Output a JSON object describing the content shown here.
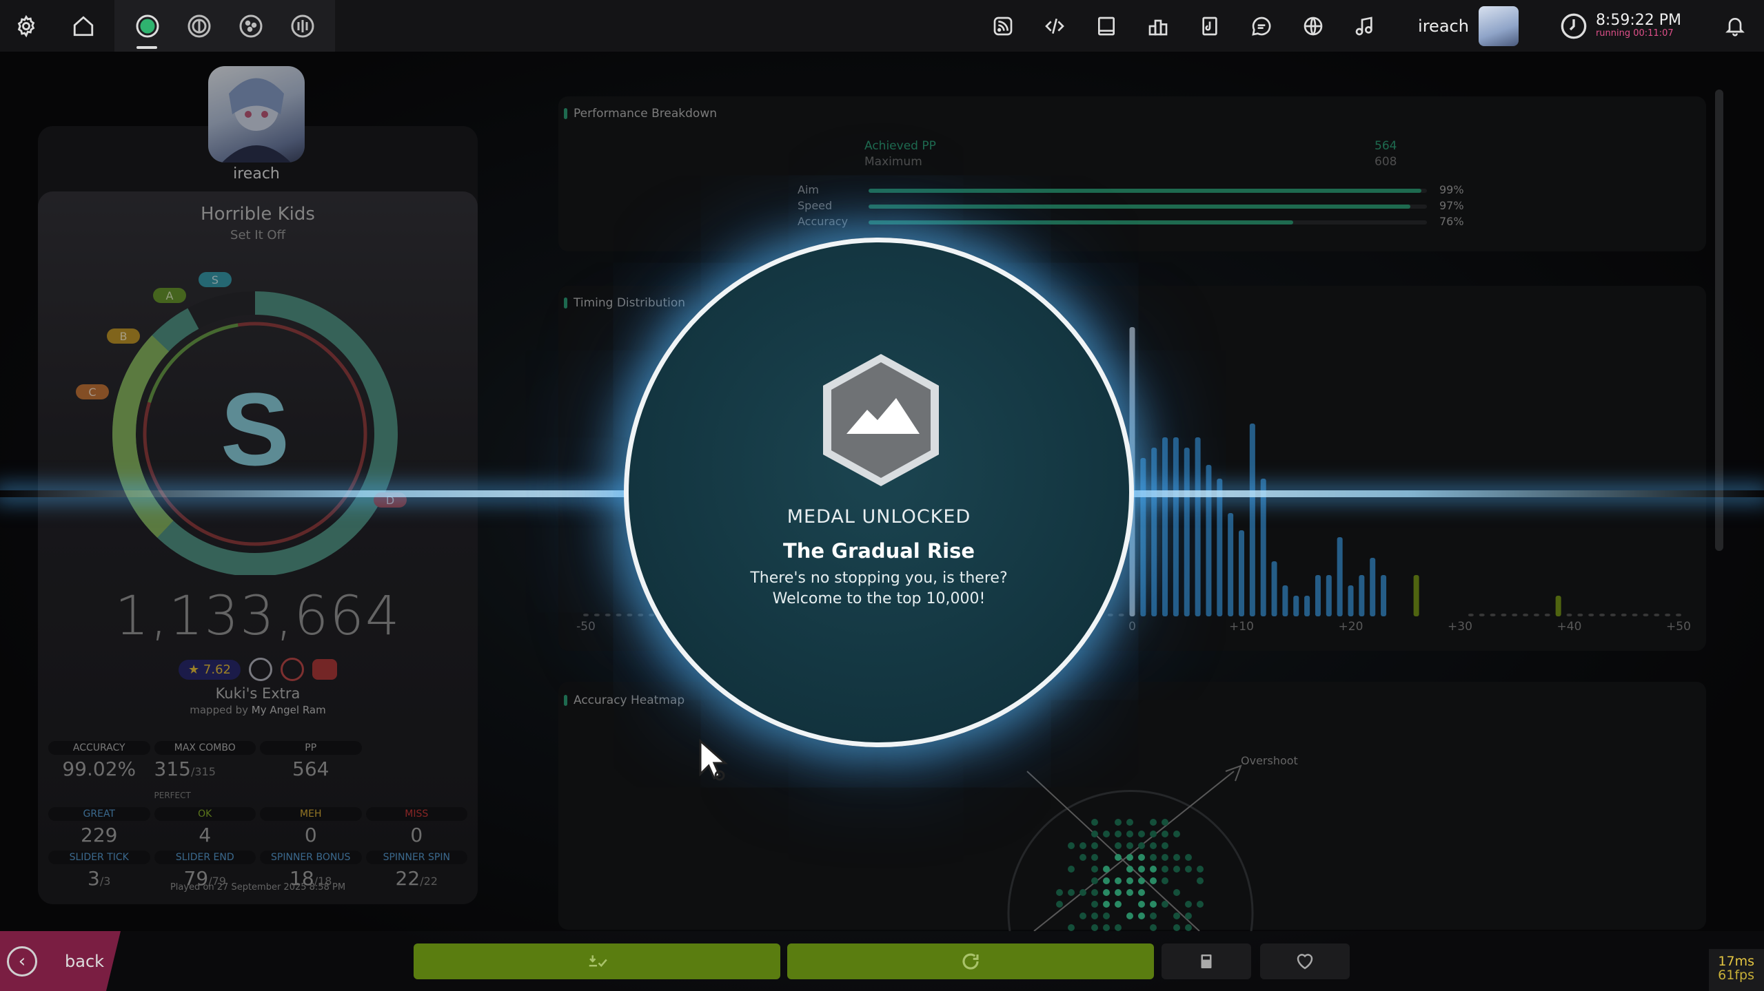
{
  "toolbar": {
    "user": "ireach",
    "time": "8:59:22 PM",
    "running": "running 00:11:07"
  },
  "player": {
    "name": "ireach"
  },
  "beatmap": {
    "title": "Horrible Kids",
    "artist": "Set It Off",
    "difficulty": "Kuki's Extra",
    "mapped_by_prefix": "mapped by",
    "mapper": "My Angel Ram",
    "star_rating": "★ 7.62"
  },
  "rank": {
    "grade": "S",
    "markers": [
      "S",
      "A",
      "B",
      "C",
      "D"
    ]
  },
  "score": "1,133,664",
  "stats": [
    {
      "label": "ACCURACY",
      "value": "99.02%",
      "extra": "",
      "color": "#bbbbbb"
    },
    {
      "label": "MAX COMBO",
      "value": "315",
      "extra": "/315",
      "note": "PERFECT",
      "color": "#bbbbbb"
    },
    {
      "label": "PP",
      "value": "564",
      "extra": "",
      "color": "#bbbbbb"
    },
    {
      "label": "",
      "value": "",
      "extra": "",
      "color": "#bbbbbb"
    },
    {
      "label": "GREAT",
      "value": "229",
      "extra": "",
      "color": "#5aa0d8"
    },
    {
      "label": "OK",
      "value": "4",
      "extra": "",
      "color": "#8ab42a"
    },
    {
      "label": "MEH",
      "value": "0",
      "extra": "",
      "color": "#e0b43a"
    },
    {
      "label": "MISS",
      "value": "0",
      "extra": "",
      "color": "#d03a3a"
    },
    {
      "label": "SLIDER TICK",
      "value": "3",
      "extra": "/3",
      "color": "#5aa0d8"
    },
    {
      "label": "SLIDER END",
      "value": "79",
      "extra": "/79",
      "color": "#5aa0d8"
    },
    {
      "label": "SPINNER BONUS",
      "value": "18",
      "extra": "/18",
      "color": "#5aa0d8"
    },
    {
      "label": "SPINNER SPIN",
      "value": "22",
      "extra": "/22",
      "color": "#5aa0d8"
    }
  ],
  "played_on": "Played on 27 September 2025 8:58 PM",
  "performance": {
    "title": "Performance Breakdown",
    "achieved_label": "Achieved PP",
    "achieved_value": "564",
    "maximum_label": "Maximum",
    "maximum_value": "608",
    "bars": [
      {
        "label": "Aim",
        "value": "99%",
        "fraction": 0.99
      },
      {
        "label": "Speed",
        "value": "97%",
        "fraction": 0.97
      },
      {
        "label": "Accuracy",
        "value": "76%",
        "fraction": 0.76
      }
    ]
  },
  "timing": {
    "title": "Timing Distribution",
    "ticks": [
      "-50",
      "0",
      "+10",
      "+20",
      "+30",
      "+40",
      "+50"
    ]
  },
  "heatmap": {
    "title": "Accuracy Heatmap",
    "overshoot": "Overshoot"
  },
  "medal": {
    "header": "MEDAL UNLOCKED",
    "name": "The Gradual Rise",
    "line1": "There's no stopping you, is there?",
    "line2": "Welcome to the top 10,000!"
  },
  "bottom": {
    "back": "back"
  },
  "perf": {
    "latency": "17ms",
    "fps": "61fps"
  }
}
